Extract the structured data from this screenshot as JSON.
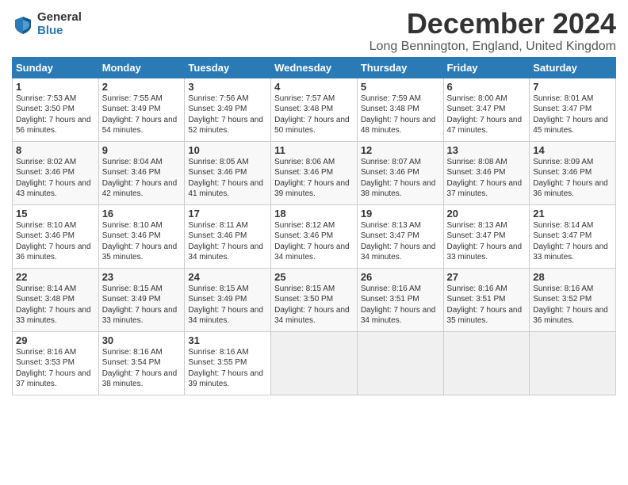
{
  "logo": {
    "general": "General",
    "blue": "Blue"
  },
  "title": "December 2024",
  "location": "Long Bennington, England, United Kingdom",
  "days_of_week": [
    "Sunday",
    "Monday",
    "Tuesday",
    "Wednesday",
    "Thursday",
    "Friday",
    "Saturday"
  ],
  "weeks": [
    [
      {
        "day": "1",
        "sunrise": "7:53 AM",
        "sunset": "3:50 PM",
        "daylight": "7 hours and 56 minutes."
      },
      {
        "day": "2",
        "sunrise": "7:55 AM",
        "sunset": "3:49 PM",
        "daylight": "7 hours and 54 minutes."
      },
      {
        "day": "3",
        "sunrise": "7:56 AM",
        "sunset": "3:49 PM",
        "daylight": "7 hours and 52 minutes."
      },
      {
        "day": "4",
        "sunrise": "7:57 AM",
        "sunset": "3:48 PM",
        "daylight": "7 hours and 50 minutes."
      },
      {
        "day": "5",
        "sunrise": "7:59 AM",
        "sunset": "3:48 PM",
        "daylight": "7 hours and 48 minutes."
      },
      {
        "day": "6",
        "sunrise": "8:00 AM",
        "sunset": "3:47 PM",
        "daylight": "7 hours and 47 minutes."
      },
      {
        "day": "7",
        "sunrise": "8:01 AM",
        "sunset": "3:47 PM",
        "daylight": "7 hours and 45 minutes."
      }
    ],
    [
      {
        "day": "8",
        "sunrise": "8:02 AM",
        "sunset": "3:46 PM",
        "daylight": "7 hours and 43 minutes."
      },
      {
        "day": "9",
        "sunrise": "8:04 AM",
        "sunset": "3:46 PM",
        "daylight": "7 hours and 42 minutes."
      },
      {
        "day": "10",
        "sunrise": "8:05 AM",
        "sunset": "3:46 PM",
        "daylight": "7 hours and 41 minutes."
      },
      {
        "day": "11",
        "sunrise": "8:06 AM",
        "sunset": "3:46 PM",
        "daylight": "7 hours and 39 minutes."
      },
      {
        "day": "12",
        "sunrise": "8:07 AM",
        "sunset": "3:46 PM",
        "daylight": "7 hours and 38 minutes."
      },
      {
        "day": "13",
        "sunrise": "8:08 AM",
        "sunset": "3:46 PM",
        "daylight": "7 hours and 37 minutes."
      },
      {
        "day": "14",
        "sunrise": "8:09 AM",
        "sunset": "3:46 PM",
        "daylight": "7 hours and 36 minutes."
      }
    ],
    [
      {
        "day": "15",
        "sunrise": "8:10 AM",
        "sunset": "3:46 PM",
        "daylight": "7 hours and 36 minutes."
      },
      {
        "day": "16",
        "sunrise": "8:10 AM",
        "sunset": "3:46 PM",
        "daylight": "7 hours and 35 minutes."
      },
      {
        "day": "17",
        "sunrise": "8:11 AM",
        "sunset": "3:46 PM",
        "daylight": "7 hours and 34 minutes."
      },
      {
        "day": "18",
        "sunrise": "8:12 AM",
        "sunset": "3:46 PM",
        "daylight": "7 hours and 34 minutes."
      },
      {
        "day": "19",
        "sunrise": "8:13 AM",
        "sunset": "3:47 PM",
        "daylight": "7 hours and 34 minutes."
      },
      {
        "day": "20",
        "sunrise": "8:13 AM",
        "sunset": "3:47 PM",
        "daylight": "7 hours and 33 minutes."
      },
      {
        "day": "21",
        "sunrise": "8:14 AM",
        "sunset": "3:47 PM",
        "daylight": "7 hours and 33 minutes."
      }
    ],
    [
      {
        "day": "22",
        "sunrise": "8:14 AM",
        "sunset": "3:48 PM",
        "daylight": "7 hours and 33 minutes."
      },
      {
        "day": "23",
        "sunrise": "8:15 AM",
        "sunset": "3:49 PM",
        "daylight": "7 hours and 33 minutes."
      },
      {
        "day": "24",
        "sunrise": "8:15 AM",
        "sunset": "3:49 PM",
        "daylight": "7 hours and 34 minutes."
      },
      {
        "day": "25",
        "sunrise": "8:15 AM",
        "sunset": "3:50 PM",
        "daylight": "7 hours and 34 minutes."
      },
      {
        "day": "26",
        "sunrise": "8:16 AM",
        "sunset": "3:51 PM",
        "daylight": "7 hours and 34 minutes."
      },
      {
        "day": "27",
        "sunrise": "8:16 AM",
        "sunset": "3:51 PM",
        "daylight": "7 hours and 35 minutes."
      },
      {
        "day": "28",
        "sunrise": "8:16 AM",
        "sunset": "3:52 PM",
        "daylight": "7 hours and 36 minutes."
      }
    ],
    [
      {
        "day": "29",
        "sunrise": "8:16 AM",
        "sunset": "3:53 PM",
        "daylight": "7 hours and 37 minutes."
      },
      {
        "day": "30",
        "sunrise": "8:16 AM",
        "sunset": "3:54 PM",
        "daylight": "7 hours and 38 minutes."
      },
      {
        "day": "31",
        "sunrise": "8:16 AM",
        "sunset": "3:55 PM",
        "daylight": "7 hours and 39 minutes."
      },
      null,
      null,
      null,
      null
    ]
  ]
}
